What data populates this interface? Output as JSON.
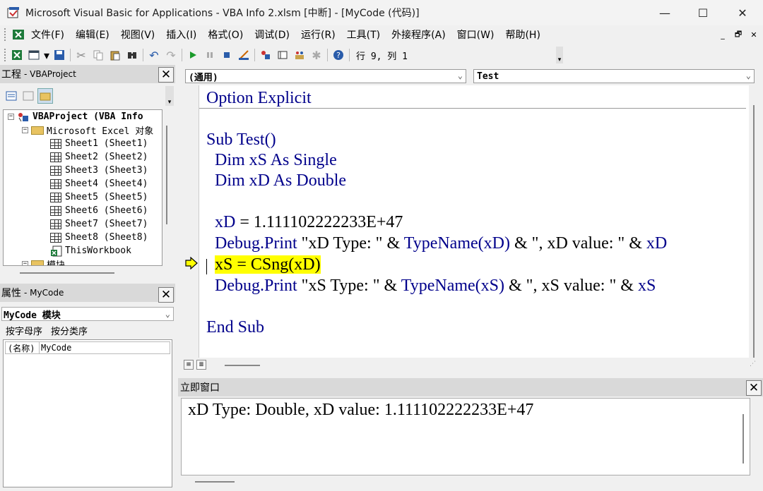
{
  "window": {
    "title": "Microsoft Visual Basic for Applications - VBA Info 2.xlsm [中断] - [MyCode (代码)]",
    "minimize": "—",
    "maximize": "☐",
    "close": "✕"
  },
  "menu": {
    "items": [
      "文件(F)",
      "编辑(E)",
      "视图(V)",
      "插入(I)",
      "格式(O)",
      "调试(D)",
      "运行(R)",
      "工具(T)",
      "外接程序(A)",
      "窗口(W)",
      "帮助(H)"
    ],
    "mdi_min": "_",
    "mdi_restore": "🗗",
    "mdi_close": "✕"
  },
  "toolbar": {
    "position": "行 9, 列 1"
  },
  "project": {
    "title": "工程",
    "subtitle": "VBAProject",
    "tree": {
      "root": "VBAProject (VBA Info",
      "excel_objects": "Microsoft Excel 对象",
      "sheets": [
        "Sheet1 (Sheet1)",
        "Sheet2 (Sheet2)",
        "Sheet3 (Sheet3)",
        "Sheet4 (Sheet4)",
        "Sheet5 (Sheet5)",
        "Sheet6 (Sheet6)",
        "Sheet7 (Sheet7)",
        "Sheet8 (Sheet8)"
      ],
      "workbook": "ThisWorkbook",
      "modules": "模块"
    }
  },
  "properties": {
    "title": "属性",
    "subtitle": "MyCode",
    "selector": "MyCode 模块",
    "tabs": [
      "按字母序",
      "按分类序"
    ],
    "row_name": "(名称)",
    "row_value": "MyCode"
  },
  "code": {
    "object_combo": "(通用)",
    "proc_combo": "Test",
    "declarations": {
      "kw1": "Option",
      "kw2": "Explicit"
    },
    "sub_line": {
      "kw": "Sub",
      "name": "Test()"
    },
    "dim1": {
      "kw1": "Dim",
      "var": "xS",
      "kw2": "As",
      "kw3": "Single"
    },
    "dim2": {
      "kw1": "Dim",
      "var": "xD",
      "kw2": "As",
      "kw3": "Double"
    },
    "assign1": {
      "var": "xD",
      "rest": " = 1.111102222233E+47"
    },
    "print1": {
      "kw1": "Debug.Print",
      "s1": " \"xD Type: \" & ",
      "kw2": "TypeName",
      "arg": "(xD)",
      "s2": " & \", xD value: \" & ",
      "var": "xD"
    },
    "current_line": "xS = CSng(xD)",
    "print2": {
      "kw1": "Debug.Print",
      "s1": " \"xS Type: \" & ",
      "kw2": "TypeName",
      "arg": "(xS)",
      "s2": " & \", xS value: \" & ",
      "var": "xS"
    },
    "end_sub": "End Sub"
  },
  "immediate": {
    "title": "立即窗口",
    "output": "xD Type: Double, xD value: 1.111102222233E+47"
  },
  "colors": {
    "keyword": "#00008b",
    "highlight": "#ffff00"
  }
}
